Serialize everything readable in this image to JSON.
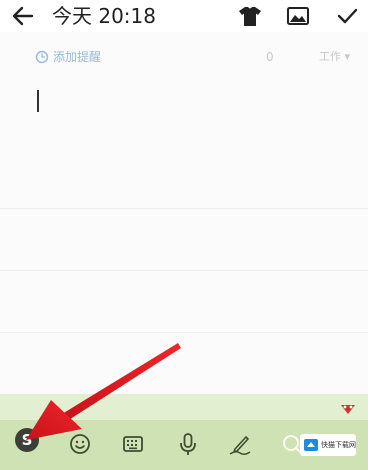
{
  "header": {
    "title": "今天 20:18",
    "back_icon": "arrow-left-icon",
    "actions": [
      "tshirt-icon",
      "image-icon",
      "check-icon"
    ]
  },
  "note": {
    "reminder_label": "添加提醒",
    "reminder_icon": "clock-icon",
    "char_count": "0",
    "category": "工作 ▾",
    "body_text": ""
  },
  "keyboard_toolbar": {
    "logo_letter": "S",
    "items": [
      "sogou-logo-icon",
      "emoji-icon",
      "keyboard-icon",
      "microphone-icon",
      "handwriting-icon",
      "search-icon"
    ],
    "badge_icon": "pin-badge-icon"
  },
  "overlay": {
    "arrow_color": "#e3161c",
    "watermark_text": "快猫下载网"
  },
  "colors": {
    "keyboard_bar": "#cfe2b3",
    "keyboard_top": "#e2efd1",
    "reminder_text": "#9ab8d8"
  }
}
